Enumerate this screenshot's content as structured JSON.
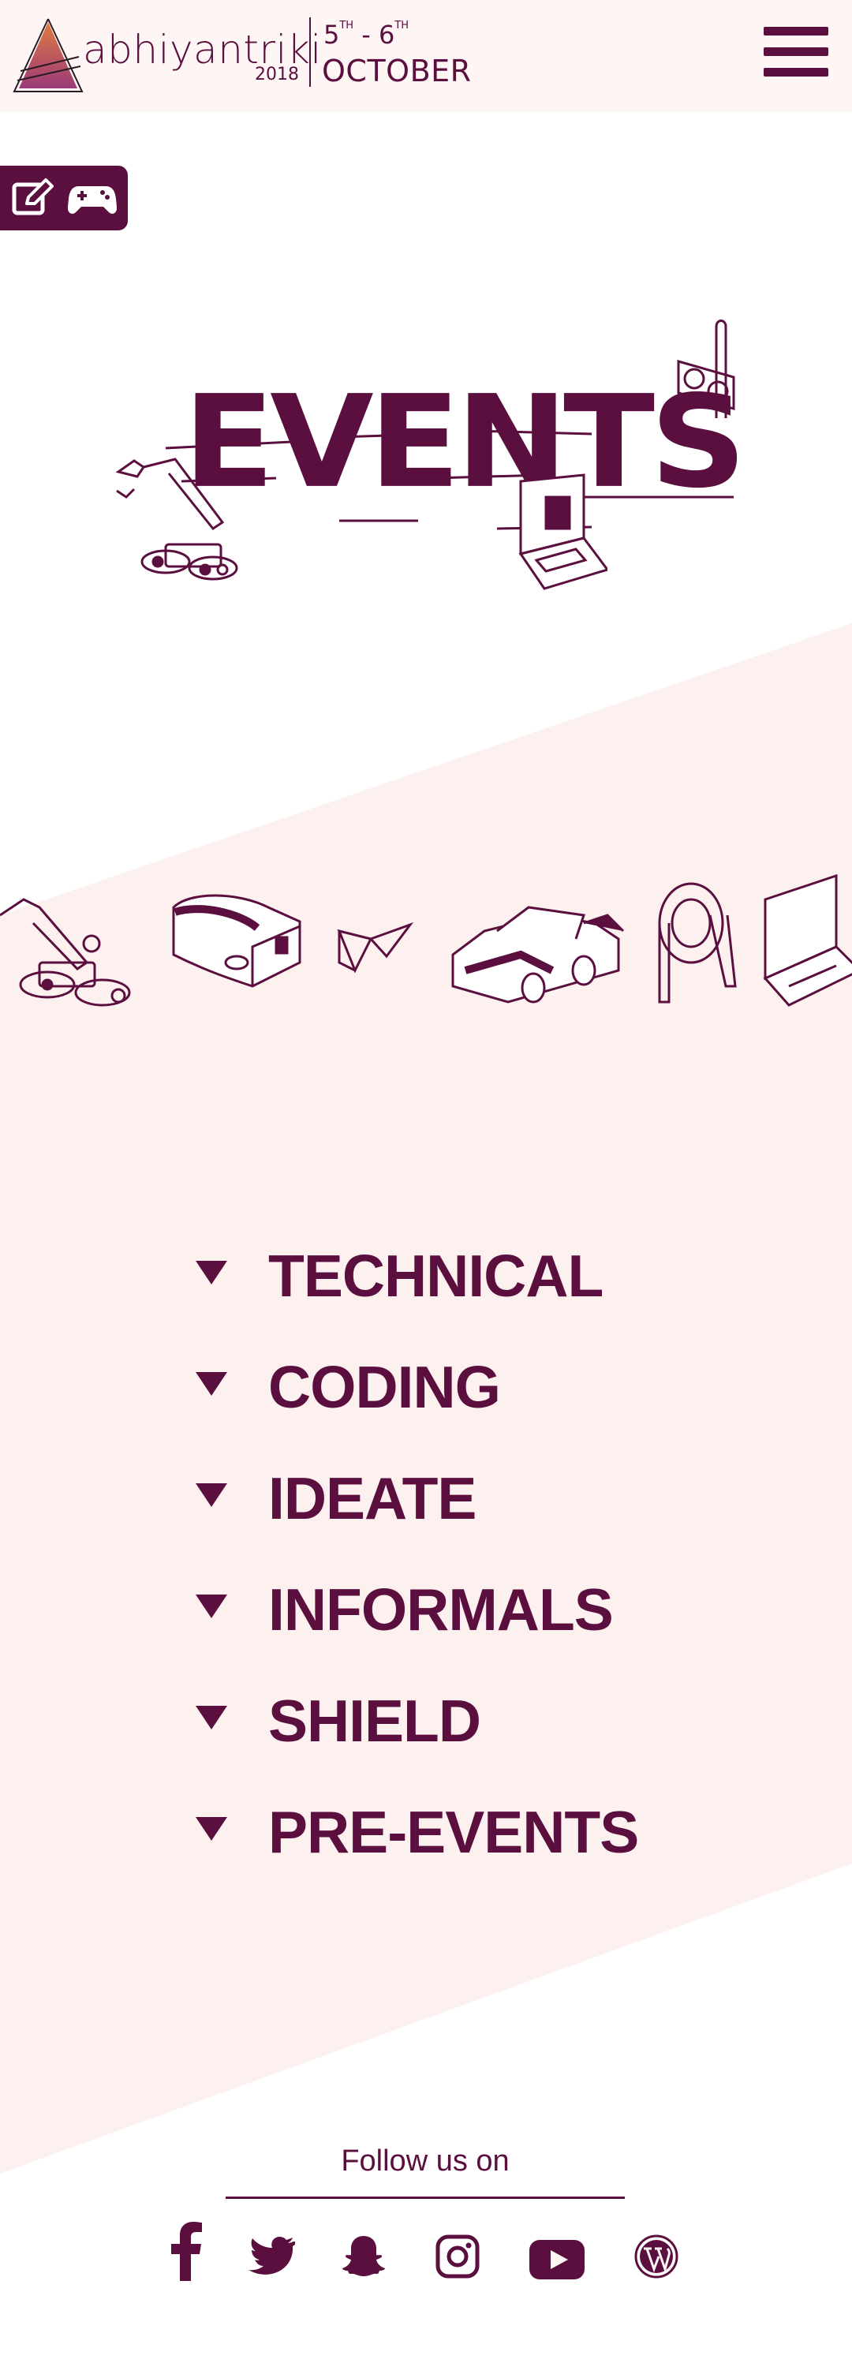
{
  "header": {
    "logo_name": "abhiyantriki",
    "logo_year": "2018",
    "date_start": "5",
    "date_start_suffix": "TH",
    "date_sep": "- 6",
    "date_end_suffix": "TH",
    "month": "OCTOBER",
    "menu_icon": "hamburger-menu-icon"
  },
  "quick_actions": [
    {
      "icon": "edit-icon"
    },
    {
      "icon": "gamepad-icon"
    }
  ],
  "hero": {
    "title": "EVENTS",
    "illustrations": [
      "robot-arm-rover-icon",
      "graphics-card-icon",
      "laptop-icon"
    ]
  },
  "illustration_row": [
    "robot-arm-rover-icon",
    "vr-headset-icon",
    "paper-plane-icon",
    "car-icon",
    "gear-rack-icon",
    "laptop-icon"
  ],
  "categories": [
    {
      "label": "TECHNICAL"
    },
    {
      "label": "CODING"
    },
    {
      "label": "IDEATE"
    },
    {
      "label": "INFORMALS"
    },
    {
      "label": "SHIELD"
    },
    {
      "label": "PRE-EVENTS"
    }
  ],
  "footer": {
    "follow_text": "Follow us on",
    "social": [
      "facebook-icon",
      "twitter-icon",
      "snapchat-icon",
      "instagram-icon",
      "youtube-icon",
      "wordpress-icon"
    ]
  },
  "colors": {
    "brand": "#5b0f3f",
    "header_bg": "#fdf6f4",
    "band_bg": "#fdf1ef"
  }
}
